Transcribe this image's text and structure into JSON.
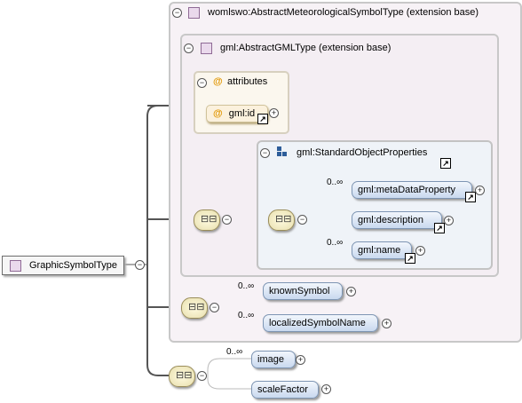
{
  "root": {
    "label": "GraphicSymbolType"
  },
  "outer_box": {
    "label": "womlswo:AbstractMeteorologicalSymbolType (extension base)"
  },
  "gml_box": {
    "label": "gml:AbstractGMLType (extension base)"
  },
  "attributes": {
    "label": "attributes",
    "items": [
      "gml:id"
    ]
  },
  "std_group": {
    "label": "gml:StandardObjectProperties"
  },
  "std_elements": [
    {
      "name": "gml:metaDataProperty",
      "occurrence": "0..∞"
    },
    {
      "name": "gml:description",
      "occurrence": ""
    },
    {
      "name": "gml:name",
      "occurrence": "0..∞"
    }
  ],
  "mid_elements": [
    {
      "name": "knownSymbol",
      "occurrence": "0..∞"
    },
    {
      "name": "localizedSymbolName",
      "occurrence": "0..∞"
    }
  ],
  "bottom_elements": [
    {
      "name": "image",
      "occurrence": "0..∞"
    },
    {
      "name": "scaleFactor",
      "occurrence": ""
    }
  ],
  "icons": {
    "collapse": "⊖",
    "expand": "+",
    "link": "↗",
    "sequence": "≡",
    "attribute": "@"
  },
  "colors": {
    "element_fill": "#c9d9ef",
    "sequence_fill": "#e8dfae",
    "attribute_fill": "#fbf1dd",
    "type_square": "#ead9ec"
  }
}
